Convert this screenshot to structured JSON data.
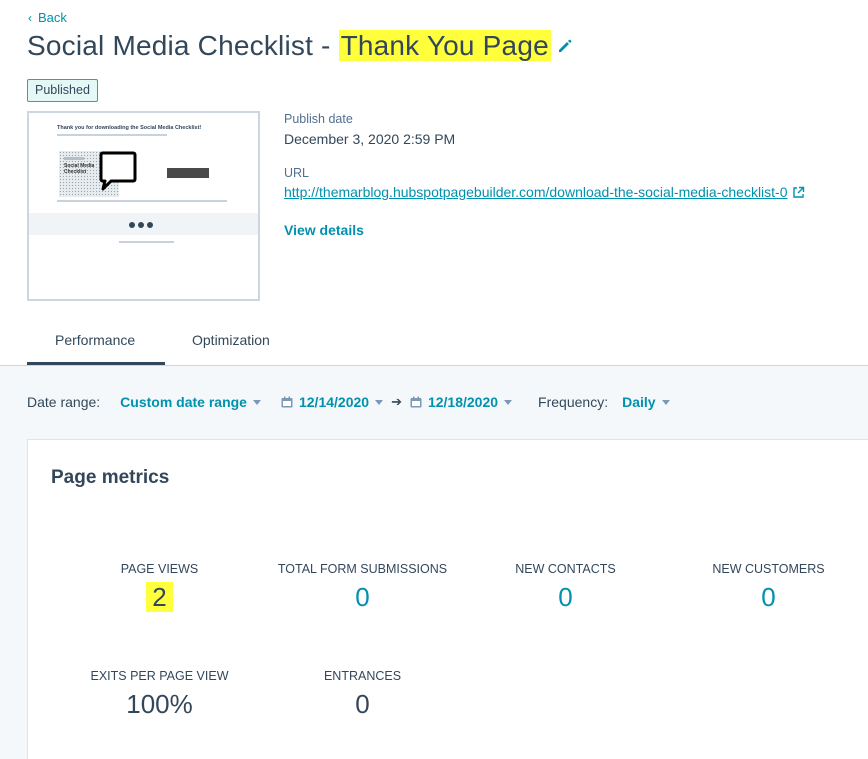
{
  "header": {
    "back_label": "Back",
    "title_main": "Social Media Checklist - ",
    "title_highlight": "Thank You Page",
    "status_badge": "Published"
  },
  "preview": {
    "heading": "Thank you for downloading the Social Media Checklist!",
    "image_line1": "Social Media",
    "image_line2": "Checklist"
  },
  "meta": {
    "publish_date_label": "Publish date",
    "publish_date_value": "December 3, 2020 2:59 PM",
    "url_label": "URL",
    "url_value": "http://themarblog.hubspotpagebuilder.com/download-the-social-media-checklist-0",
    "view_details": "View details"
  },
  "tabs": [
    {
      "label": "Performance",
      "active": true
    },
    {
      "label": "Optimization",
      "active": false
    }
  ],
  "filters": {
    "date_range_label": "Date range:",
    "date_range_value": "Custom date range",
    "start_date": "12/14/2020",
    "end_date": "12/18/2020",
    "frequency_label": "Frequency:",
    "frequency_value": "Daily"
  },
  "page_metrics": {
    "title": "Page metrics",
    "items": [
      {
        "label": "PAGE VIEWS",
        "value": "2"
      },
      {
        "label": "TOTAL FORM SUBMISSIONS",
        "value": "0"
      },
      {
        "label": "NEW CONTACTS",
        "value": "0"
      },
      {
        "label": "NEW CUSTOMERS",
        "value": "0"
      },
      {
        "label": "EXITS PER PAGE VIEW",
        "value": "100%"
      },
      {
        "label": "ENTRANCES",
        "value": "0"
      }
    ]
  },
  "colors": {
    "accent": "#0091ae",
    "text": "#33475b",
    "highlight": "#ffff3b",
    "badge_border": "#00bda5"
  }
}
